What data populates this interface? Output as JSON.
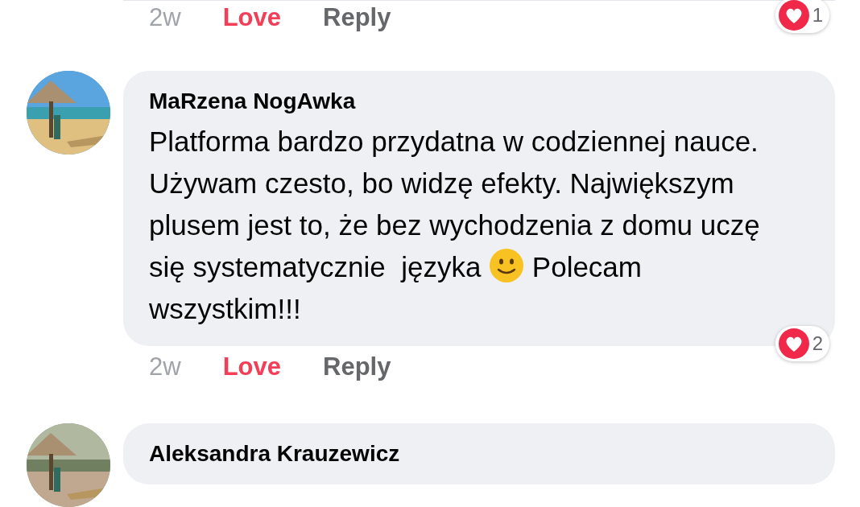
{
  "comments": [
    {
      "actions": {
        "time": "2w",
        "reaction_label": "Love",
        "reacted": true,
        "reply": "Reply",
        "reaction_count": "1"
      }
    },
    {
      "author": "MaRzena NogAwka",
      "body": [
        {
          "kind": "text",
          "text": "Platforma bardzo przydatna w codziennej nauce. Używam czesto, bo widzę efekty. Największym plusem jest to, że bez wychodzenia z domu uczę się systematycznie  języka "
        },
        {
          "kind": "emoji"
        },
        {
          "kind": "text",
          "text": " Polecam wszystkim!!!"
        }
      ],
      "actions": {
        "time": "2w",
        "reaction_label": "Love",
        "reacted": true,
        "reply": "Reply",
        "reaction_count": "2"
      }
    },
    {
      "author": "Aleksandra Krauzewicz"
    }
  ]
}
